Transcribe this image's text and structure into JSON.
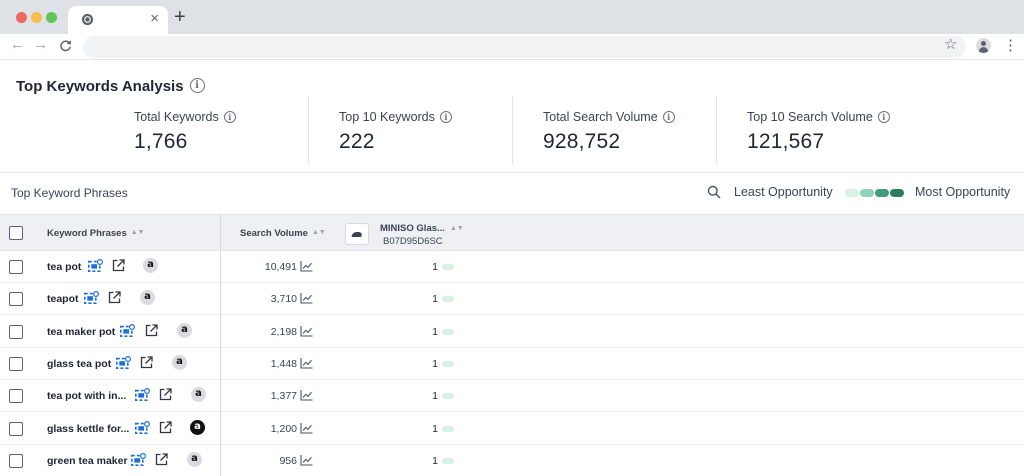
{
  "browser": {
    "tab_close": "×",
    "new_tab": "+",
    "back": "←",
    "forward": "→",
    "reload": "C",
    "star": "☆",
    "menu": "⋮"
  },
  "page": {
    "title": "Top Keywords Analysis",
    "info_glyph": "i"
  },
  "stats": [
    {
      "label": "Total Keywords",
      "value": "1,766"
    },
    {
      "label": "Top 10 Keywords",
      "value": "222"
    },
    {
      "label": "Total Search Volume",
      "value": "928,752"
    },
    {
      "label": "Top 10 Search Volume",
      "value": "121,567"
    }
  ],
  "section": {
    "title": "Top Keyword Phrases",
    "least_label": "Least Opportunity",
    "most_label": "Most Opportunity",
    "scale_colors": [
      "#d8f3e6",
      "#8fd4b6",
      "#3f9e78",
      "#2b7d5c"
    ]
  },
  "table": {
    "headers": {
      "keyword": "Keyword Phrases",
      "search_volume": "Search Volume",
      "product_name": "MINISO Glas...",
      "product_asin": "B07D95D6SC"
    },
    "sort_glyph": "▲▼",
    "amazon_glyph": "a",
    "pill_color": "#d8f3e6",
    "rows": [
      {
        "keyword": "tea pot",
        "search_volume": "10,491",
        "rank": "1"
      },
      {
        "keyword": "teapot",
        "search_volume": "3,710",
        "rank": "1"
      },
      {
        "keyword": "tea maker pot",
        "search_volume": "2,198",
        "rank": "1"
      },
      {
        "keyword": "glass tea pot",
        "search_volume": "1,448",
        "rank": "1"
      },
      {
        "keyword": "tea pot with in...",
        "search_volume": "1,377",
        "rank": "1"
      },
      {
        "keyword": "glass kettle for...",
        "search_volume": "1,200",
        "rank": "1"
      },
      {
        "keyword": "green tea maker",
        "search_volume": "956",
        "rank": "1"
      }
    ]
  }
}
